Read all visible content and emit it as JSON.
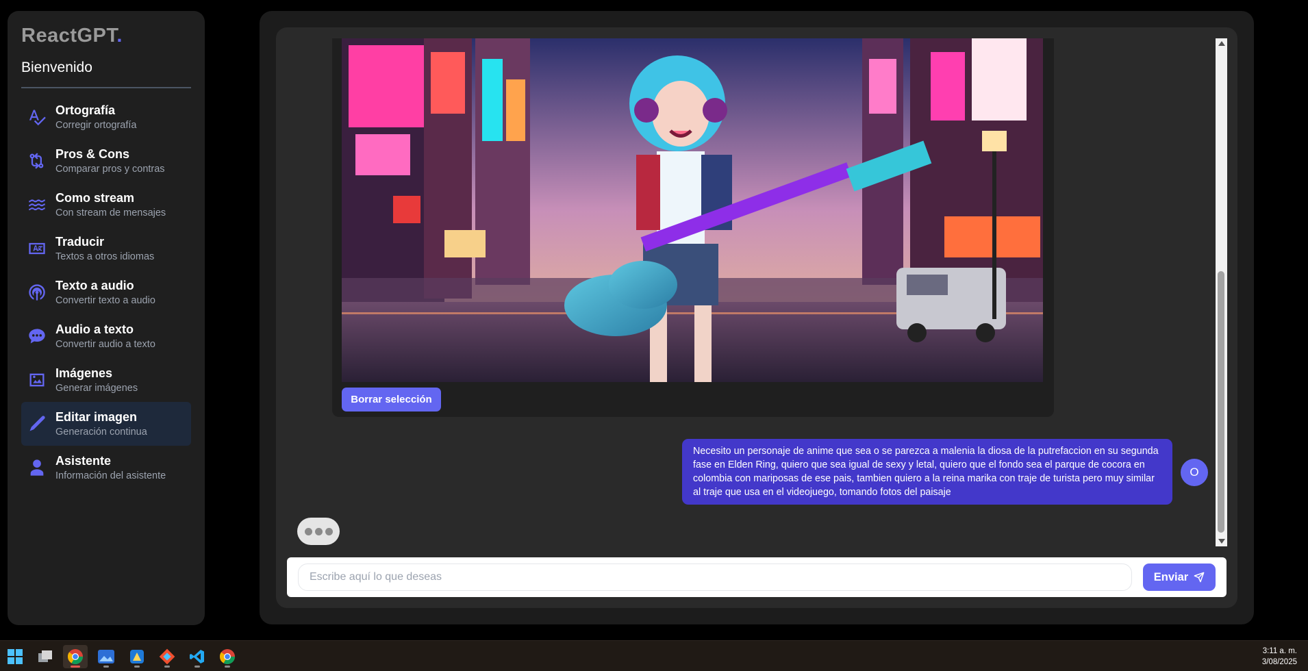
{
  "sidebar": {
    "brand": "ReactGPT",
    "brand_dot": ".",
    "welcome": "Bienvenido",
    "items": [
      {
        "title": "Ortografía",
        "subtitle": "Corregir ortografía",
        "icon": "spellcheck-icon",
        "active": false
      },
      {
        "title": "Pros & Cons",
        "subtitle": "Comparar pros y contras",
        "icon": "compare-arrows-icon",
        "active": false
      },
      {
        "title": "Como stream",
        "subtitle": "Con stream de mensajes",
        "icon": "waves-icon",
        "active": false
      },
      {
        "title": "Traducir",
        "subtitle": "Textos a otros idiomas",
        "icon": "translate-icon",
        "active": false
      },
      {
        "title": "Texto a audio",
        "subtitle": "Convertir texto a audio",
        "icon": "podcast-icon",
        "active": false
      },
      {
        "title": "Audio a texto",
        "subtitle": "Convertir audio a texto",
        "icon": "chat-bubble-icon",
        "active": false
      },
      {
        "title": "Imágenes",
        "subtitle": "Generar imágenes",
        "icon": "image-icon",
        "active": false
      },
      {
        "title": "Editar imagen",
        "subtitle": "Generación continua",
        "icon": "pencil-icon",
        "active": true
      },
      {
        "title": "Asistente",
        "subtitle": "Información del asistente",
        "icon": "user-icon",
        "active": false
      }
    ]
  },
  "chat": {
    "clear_button": "Borrar selección",
    "user_message": "Necesito un personaje de anime que sea o se parezca a malenia la diosa de la putrefaccion en su segunda fase en Elden Ring, quiero que sea igual de sexy y letal, quiero que el fondo sea el parque de cocora en colombia con mariposas de ese pais, tambien quiero a la reina marika con traje de turista pero muy similar al traje que usa en el videojuego, tomando fotos del paisaje",
    "user_avatar": "O"
  },
  "input": {
    "placeholder": "Escribe aquí lo que deseas",
    "value": "",
    "send_label": "Enviar"
  },
  "taskbar": {
    "time": "3:11 a. m.",
    "date": "3/08/2025"
  },
  "colors": {
    "accent": "#6366f1",
    "user_bubble": "#4338ca",
    "sidebar_bg": "#1f1f1f",
    "active_item_bg": "#1e293b"
  }
}
